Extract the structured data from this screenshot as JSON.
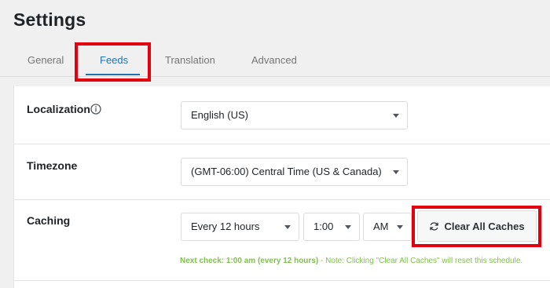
{
  "page": {
    "title": "Settings"
  },
  "tabs": [
    {
      "label": "General",
      "active": false
    },
    {
      "label": "Feeds",
      "active": true
    },
    {
      "label": "Translation",
      "active": false
    },
    {
      "label": "Advanced",
      "active": false
    }
  ],
  "settings": {
    "localization": {
      "label": "Localization",
      "icon": "info-icon",
      "value": "English (US)"
    },
    "timezone": {
      "label": "Timezone",
      "value": "(GMT-06:00) Central Time (US & Canada)"
    },
    "caching": {
      "label": "Caching",
      "interval": "Every 12 hours",
      "time": "1:00",
      "period": "AM",
      "clear_button": "Clear All Caches",
      "clear_icon": "refresh-icon",
      "note_strong": "Next check: 1:00 am (every 12 hours)",
      "note_rest": " - Note: Clicking \"Clear All Caches\" will reset this schedule."
    }
  },
  "colors": {
    "accent": "#2271b1",
    "highlight": "#e3000f",
    "note": "#7fbf4d",
    "background": "#f0f0f1"
  }
}
